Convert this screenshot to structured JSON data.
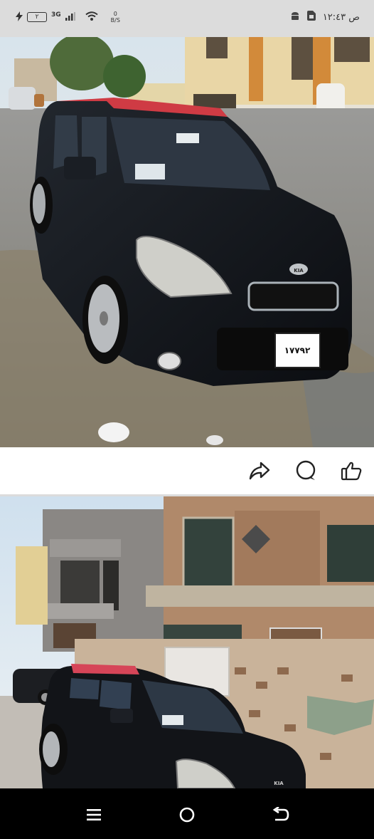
{
  "status_bar": {
    "battery_level": "٢",
    "network_type": "3G",
    "net_speed_top": "0",
    "net_speed_unit": "B/S",
    "time": "١٢:٤٣",
    "am_pm": "ص"
  },
  "post": {
    "photo1_plate": "١٧٧٩٢",
    "photo1_brand": "KIA",
    "photo2_brand": "KIA"
  },
  "actions": {
    "share_icon": "share-icon",
    "comment_icon": "comment-icon",
    "like_icon": "thumbs-up-icon"
  },
  "nav": {
    "menu_icon": "menu-icon",
    "home_icon": "home-circle-icon",
    "back_icon": "back-icon"
  }
}
